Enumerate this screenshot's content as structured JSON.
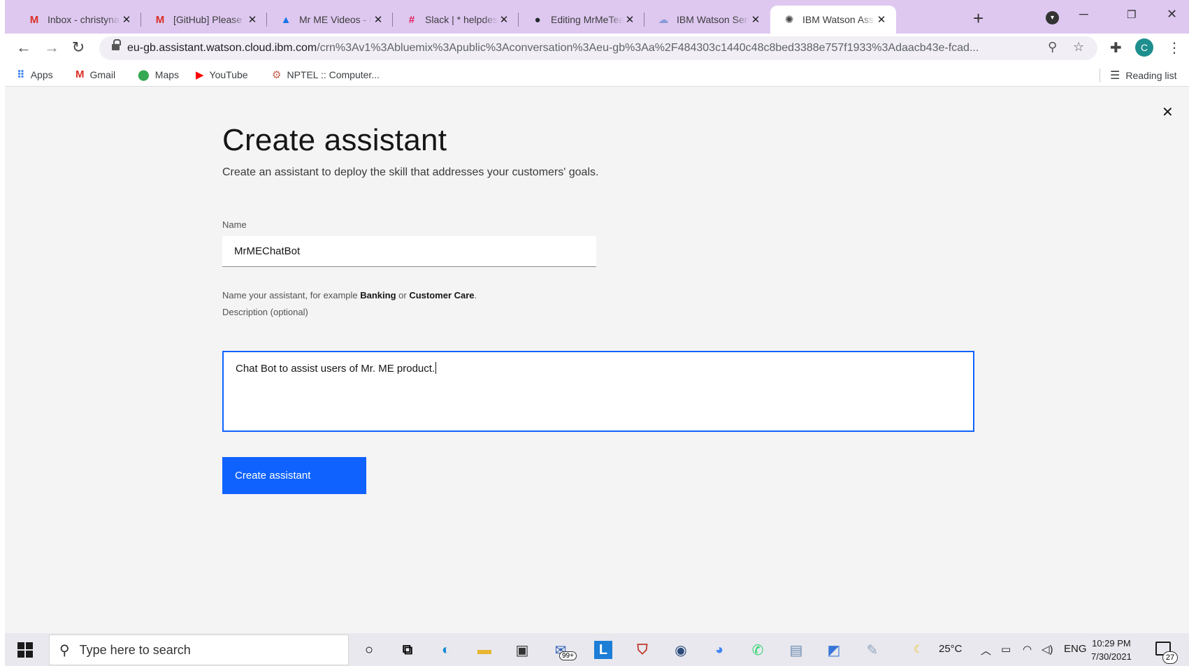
{
  "browser": {
    "tabs": [
      {
        "title": "Inbox - christynac",
        "favicon": "gmail-icon",
        "color": "#d93025"
      },
      {
        "title": "[GitHub] Please v",
        "favicon": "gmail-icon",
        "color": "#d93025"
      },
      {
        "title": "Mr ME Videos - G",
        "favicon": "google-drive-icon",
        "color": "#1a73e8"
      },
      {
        "title": "Slack | * helpdesk",
        "favicon": "slack-icon",
        "color": "#e01e5a"
      },
      {
        "title": "Editing MrMeTea",
        "favicon": "github-icon",
        "color": "#24292e"
      },
      {
        "title": "IBM Watson Servi",
        "favicon": "ibm-cloud-icon",
        "color": "#8a9bd8"
      },
      {
        "title": "IBM Watson Assis",
        "favicon": "watson-icon",
        "color": "#444444",
        "active": true
      }
    ],
    "url_host": "eu-gb.assistant.watson.cloud.ibm.com",
    "url_rest": "/crn%3Av1%3Abluemix%3Apublic%3Aconversation%3Aeu-gb%3Aa%2F484303c1440c48c8bed3388e757f1933%3Adaacb43e-fcad...",
    "profile_initial": "C",
    "bookmarks": [
      {
        "label": "Apps",
        "icon": "apps-grid-icon"
      },
      {
        "label": "Gmail",
        "icon": "gmail-icon"
      },
      {
        "label": "Maps",
        "icon": "maps-pin-icon"
      },
      {
        "label": "YouTube",
        "icon": "youtube-icon"
      },
      {
        "label": "NPTEL :: Computer...",
        "icon": "nptel-icon"
      }
    ],
    "reading_list": "Reading list"
  },
  "page": {
    "title": "Create assistant",
    "subtitle": "Create an assistant to deploy the skill that addresses your customers' goals.",
    "name_label": "Name",
    "name_value": "MrMEChatBot",
    "helper_prefix": "Name your assistant, for example ",
    "helper_ex1": "Banking",
    "helper_mid": " or ",
    "helper_ex2": "Customer Care",
    "helper_suffix": ".",
    "description_label": "Description (optional)",
    "description_value": "Chat Bot to assist users of Mr. ME product.",
    "create_button": "Create assistant",
    "accent_color": "#0f62fe"
  },
  "taskbar": {
    "search_placeholder": "Type here to search",
    "weather": "25°C",
    "language": "ENG",
    "time": "10:29 PM",
    "date": "7/30/2021",
    "notification_count": "27",
    "store_badge": "99+"
  }
}
